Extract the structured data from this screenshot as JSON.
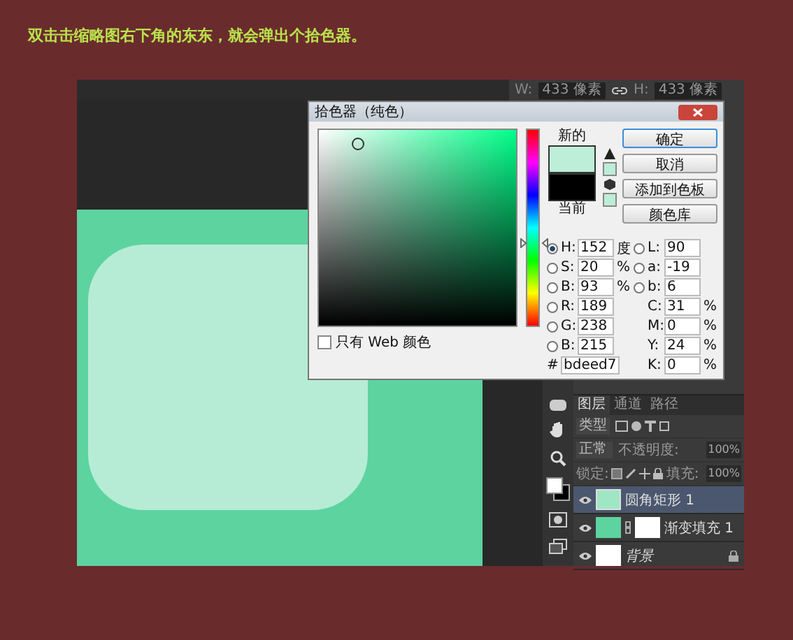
{
  "caption": "双击击缩略图右下角的东东，就会弹出个拾色器。",
  "options_bar": {
    "width_label": "W:",
    "width_value": "433 像素",
    "height_label": "H:",
    "height_value": "433 像素"
  },
  "color_picker": {
    "title": "拾色器（纯色）",
    "new_label": "新的",
    "current_label": "当前",
    "buttons": [
      {
        "label": "确定",
        "default": true
      },
      {
        "label": "取消",
        "default": false
      },
      {
        "label": "添加到色板",
        "default": false
      },
      {
        "label": "颜色库",
        "default": false
      }
    ],
    "left_fields": [
      {
        "label": "H:",
        "value": "152",
        "unit": "度",
        "selected": true
      },
      {
        "label": "S:",
        "value": "20",
        "unit": "%",
        "selected": false
      },
      {
        "label": "B:",
        "value": "93",
        "unit": "%",
        "selected": false
      },
      {
        "label": "R:",
        "value": "189",
        "selected": false
      },
      {
        "label": "G:",
        "value": "238",
        "selected": false
      },
      {
        "label": "B:",
        "value": "215",
        "selected": false
      }
    ],
    "right_fields": [
      {
        "label": "L:",
        "value": "90",
        "kind": "radio",
        "selected": false
      },
      {
        "label": "a:",
        "value": "-19",
        "kind": "radio",
        "selected": false
      },
      {
        "label": "b:",
        "value": "6",
        "kind": "radio",
        "selected": false
      },
      {
        "label": "C:",
        "value": "31",
        "unit": "%",
        "kind": "plain"
      },
      {
        "label": "M:",
        "value": "0",
        "unit": "%",
        "kind": "plain"
      },
      {
        "label": "Y:",
        "value": "24",
        "unit": "%",
        "kind": "plain"
      },
      {
        "label": "K:",
        "value": "0",
        "unit": "%",
        "kind": "plain"
      }
    ],
    "hue_slider": {
      "level": 0.42
    },
    "hex_label": "#",
    "hex": "bdeed7",
    "web_only": {
      "label": "只有 Web 颜色",
      "checked": false
    }
  },
  "layers_panel": {
    "tabs": [
      {
        "label": "图层",
        "selected": true
      },
      {
        "label": "通道",
        "selected": false
      },
      {
        "label": "路径",
        "selected": false
      }
    ],
    "filter": "类型",
    "blend_mode": "正常",
    "opacity_label": "不透明度:",
    "opacity": "100%",
    "lock_label": "锁定:",
    "fill_label": "填充:",
    "fill": "100%",
    "layers": [
      {
        "name": "圆角矩形 1",
        "kind": "shape",
        "selected": true,
        "locked": false
      },
      {
        "name": "渐变填充 1",
        "kind": "fill",
        "selected": false,
        "locked": false
      },
      {
        "name": "背景",
        "kind": "background",
        "selected": false,
        "locked": true
      }
    ]
  }
}
